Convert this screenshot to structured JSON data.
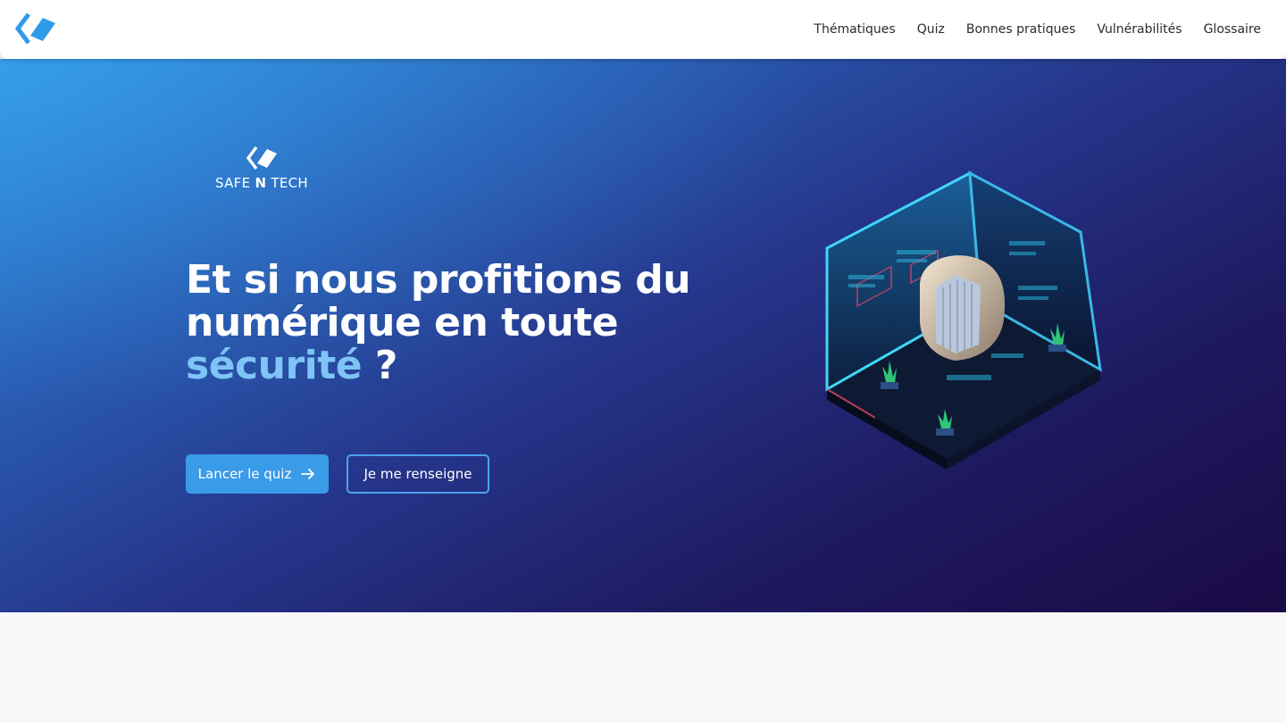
{
  "nav": {
    "logo_icon": "safe-n-tech-logo-icon",
    "items": [
      {
        "label": "Thématiques"
      },
      {
        "label": "Quiz"
      },
      {
        "label": "Bonnes pratiques"
      },
      {
        "label": "Vulnérabilités"
      },
      {
        "label": "Glossaire"
      }
    ]
  },
  "hero": {
    "brand": {
      "part1": "SAFE ",
      "part2": "N",
      "part3": " TECH"
    },
    "headline": {
      "line1": "Et si nous profitions du",
      "line2": "numérique en toute",
      "accent": "sécurité",
      "end": " ?"
    },
    "primary_button": {
      "label": "Lancer le quiz",
      "icon": "arrow-right-icon"
    },
    "secondary_button": {
      "label": "Je me renseigne"
    }
  },
  "colors": {
    "accent": "#3a9be8",
    "headline_accent": "#7ec4f6",
    "hero_gradient_start": "#2f95e3",
    "hero_gradient_end": "#1a0a45",
    "page_background": "#f8f8f8"
  }
}
